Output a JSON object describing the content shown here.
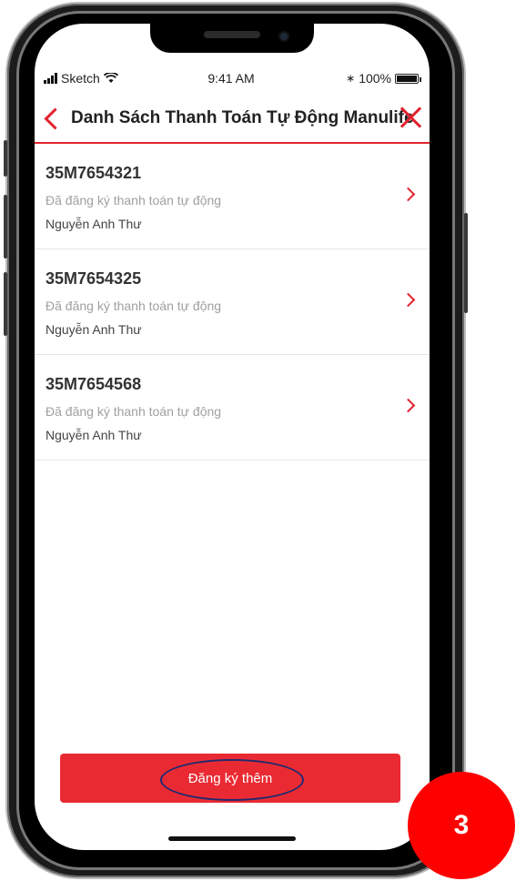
{
  "status_bar": {
    "carrier": "Sketch",
    "time": "9:41 AM",
    "battery": "100%"
  },
  "header": {
    "title": "Danh Sách Thanh Toán Tự Động Manulife"
  },
  "policies": [
    {
      "code": "35M7654321",
      "status": "Đã đăng ký thanh toán tự động",
      "name": "Nguyễn Anh Thư"
    },
    {
      "code": "35M7654325",
      "status": "Đã đăng ký thanh toán tự động",
      "name": "Nguyễn Anh Thư"
    },
    {
      "code": "35M7654568",
      "status": "Đã đăng ký thanh toán tự động",
      "name": "Nguyễn Anh Thư"
    }
  ],
  "actions": {
    "register_more_label": "Đăng ký thêm"
  },
  "annotation": {
    "step": "3"
  },
  "colors": {
    "accent": "#e0232d",
    "button": "#ea2a33",
    "badge": "#ff0000",
    "oval": "#1f2a70"
  }
}
